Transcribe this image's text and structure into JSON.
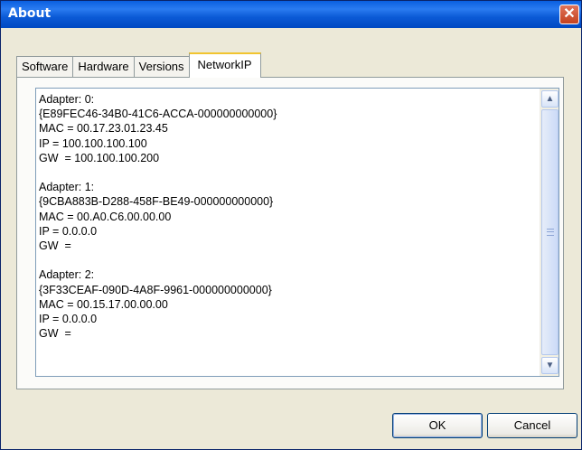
{
  "window": {
    "title": "About",
    "close_glyph": "✕"
  },
  "tabs": [
    {
      "label": "Software",
      "active": false
    },
    {
      "label": "Hardware",
      "active": false
    },
    {
      "label": "Versions",
      "active": false
    },
    {
      "label": "NetworkIP",
      "active": true
    }
  ],
  "network_text": "Adapter: 0:\n{E89FEC46-34B0-41C6-ACCA-000000000000}\nMAC = 00.17.23.01.23.45\nIP = 100.100.100.100\nGW  = 100.100.100.200\n\nAdapter: 1:\n{9CBA883B-D288-458F-BE49-000000000000}\nMAC = 00.A0.C6.00.00.00\nIP = 0.0.0.0\nGW  =\n\nAdapter: 2:\n{3F33CEAF-090D-4A8F-9961-000000000000}\nMAC = 00.15.17.00.00.00\nIP = 0.0.0.0\nGW  =",
  "scrollbar": {
    "up_glyph": "▲",
    "down_glyph": "▼"
  },
  "buttons": {
    "ok": "OK",
    "cancel": "Cancel"
  },
  "colors": {
    "titlebar": "#0b5ad6",
    "close": "#c4421e",
    "dialog_bg": "#ece9d8"
  }
}
